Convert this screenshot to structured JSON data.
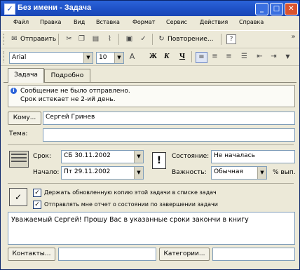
{
  "window": {
    "title": "Без имени - Задача",
    "title_icon": "task-check-icon"
  },
  "menu": [
    "Файл",
    "Правка",
    "Вид",
    "Вставка",
    "Формат",
    "Сервис",
    "Действия",
    "Справка"
  ],
  "toolbar1": {
    "send_label": "Отправить",
    "recurrence_label": "Повторение...",
    "help_icon": "?",
    "more": "»"
  },
  "toolbar2": {
    "font": "Arial",
    "size": "10",
    "bold": "Ж",
    "italic": "К",
    "underline": "Ч"
  },
  "tabs": [
    {
      "label": "Задача"
    },
    {
      "label": "Подробно"
    }
  ],
  "info": {
    "line1": "Сообщение не было отправлено.",
    "line2": "Срок истекает не 2-ий день."
  },
  "to": {
    "button": "Кому...",
    "value": "Сергей Гринев"
  },
  "subject": {
    "label": "Тема:",
    "value": ""
  },
  "due": {
    "label": "Срок:",
    "value": "СБ 30.11.2002"
  },
  "start": {
    "label": "Начало:",
    "value": "Пт 29.11.2002"
  },
  "status": {
    "label": "Состояние:",
    "value": "Не началась"
  },
  "priority": {
    "label": "Важность:",
    "value": "Обычная",
    "percent_label": "% вып."
  },
  "options": [
    {
      "label": "Держать обновленную копию этой задачи в списке задач",
      "checked": true
    },
    {
      "label": "Отправлять мне отчет о состоянии по завершении задачи",
      "checked": true
    }
  ],
  "body": "Уважаемый Сергей! Прошу Вас в указанные сроки закончи в книгу",
  "footer": {
    "contacts_button": "Контакты...",
    "contacts_value": "",
    "categories_button": "Категории...",
    "categories_value": ""
  }
}
